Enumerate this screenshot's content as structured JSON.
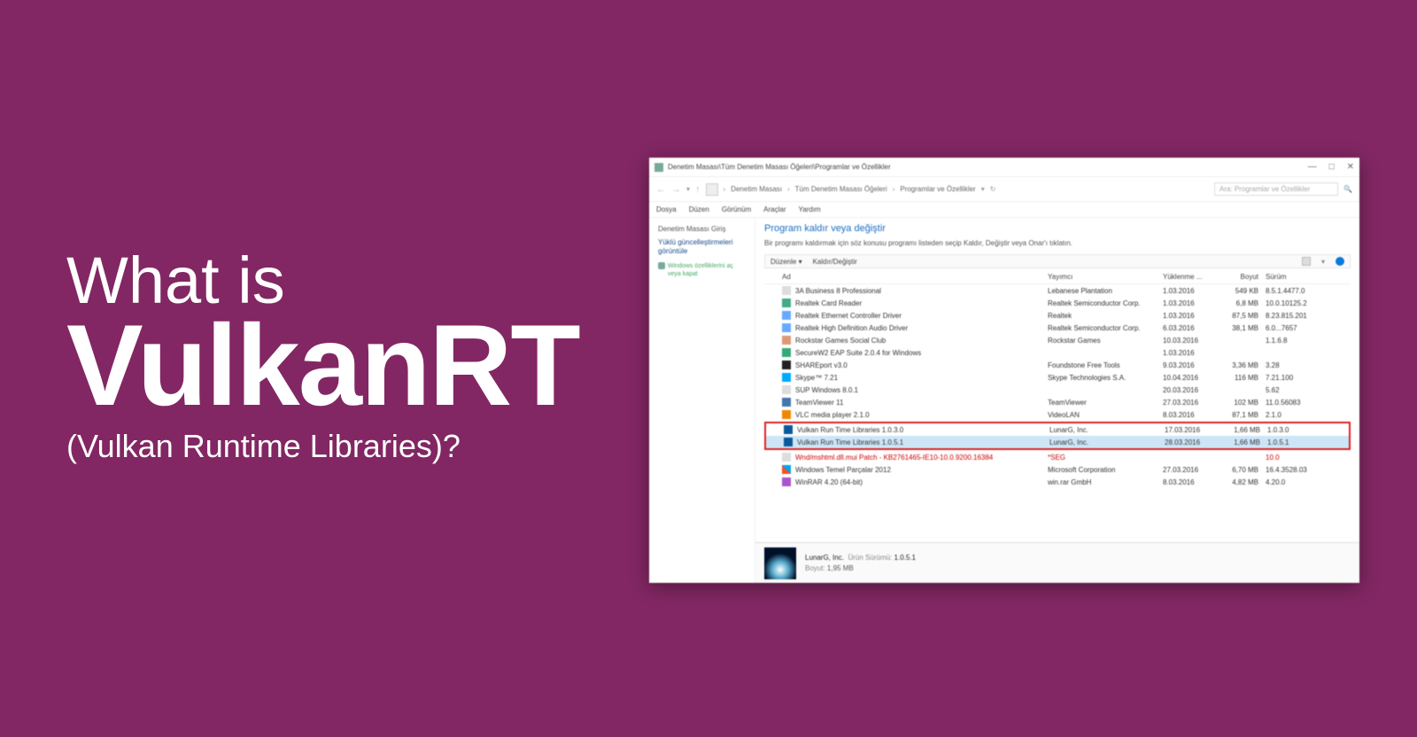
{
  "hero": {
    "line1": "What is",
    "line2": "VulkanRT",
    "line3": "(Vulkan Runtime Libraries)?"
  },
  "window": {
    "title": "Denetim Masası\\Tüm Denetim Masası Öğeleri\\Programlar ve Özellikler",
    "controls": {
      "min": "—",
      "max": "□",
      "close": "✕"
    },
    "nav": {
      "back": "←",
      "fwd": "→",
      "up": "↑",
      "crumbs": [
        "Denetim Masası",
        "Tüm Denetim Masası Öğeleri",
        "Programlar ve Özellikler"
      ],
      "search_placeholder": "Ara: Programlar ve Özellikler",
      "refresh": "↻"
    },
    "menu": [
      "Dosya",
      "Düzen",
      "Görünüm",
      "Araçlar",
      "Yardım"
    ],
    "sidebar": {
      "head": "Denetim Masası Giriş",
      "links": [
        "Yüklü güncelleştirmeleri görüntüle",
        "Windows özelliklerini aç veya kapat"
      ]
    },
    "main": {
      "title": "Program kaldır veya değiştir",
      "subtitle": "Bir programı kaldırmak için söz konusu programı listeden seçip Kaldır, Değiştir veya Onar'ı tıklatın."
    },
    "toolbar": {
      "organize": "Düzenle ▾",
      "change": "Kaldır/Değiştir"
    },
    "columns": {
      "name": "Ad",
      "publisher": "Yayımcı",
      "date": "Yüklenme ...",
      "size": "Boyut",
      "version": "Sürüm"
    },
    "programs": [
      {
        "name": "3A Business 8 Professional",
        "publisher": "Lebanese Plantation",
        "date": "1.03.2016",
        "size": "549 KB",
        "version": "8.5.1.4477.0",
        "ico": "generic"
      },
      {
        "name": "Realtek Card Reader",
        "publisher": "Realtek Semiconductor Corp.",
        "date": "1.03.2016",
        "size": "6,8 MB",
        "version": "10.0.10125.2",
        "ico": "blue"
      },
      {
        "name": "Realtek Ethernet Controller Driver",
        "publisher": "Realtek",
        "date": "1.03.2016",
        "size": "87,5 MB",
        "version": "8.23.815.201",
        "ico": "network"
      },
      {
        "name": "Realtek High Definition Audio Driver",
        "publisher": "Realtek Semiconductor Corp.",
        "date": "6.03.2016",
        "size": "38,1 MB",
        "version": "6.0...7657",
        "ico": "network"
      },
      {
        "name": "Rockstar Games Social Club",
        "publisher": "Rockstar Games",
        "date": "10.03.2016",
        "size": "",
        "version": "1.1.6.8",
        "ico": "box"
      },
      {
        "name": "SecureW2 EAP Suite 2.0.4 for Windows",
        "publisher": "",
        "date": "1.03.2016",
        "size": "",
        "version": "",
        "ico": "shield"
      },
      {
        "name": "SHAREport v3.0",
        "publisher": "Foundstone Free Tools",
        "date": "9.03.2016",
        "size": "3,36 MB",
        "version": "3.28",
        "ico": "black"
      },
      {
        "name": "Skype™ 7.21",
        "publisher": "Skype Technologies S.A.",
        "date": "10.04.2016",
        "size": "116 MB",
        "version": "7.21.100",
        "ico": "skype"
      },
      {
        "name": "SUP Windows 8.0.1",
        "publisher": "",
        "date": "20.03.2016",
        "size": "",
        "version": "5.62",
        "ico": "generic"
      },
      {
        "name": "TeamViewer 11",
        "publisher": "TeamViewer",
        "date": "27.03.2016",
        "size": "102 MB",
        "version": "11.0.56083",
        "ico": "team"
      },
      {
        "name": "VLC media player 2.1.0",
        "publisher": "VideoLAN",
        "date": "8.03.2016",
        "size": "87,1 MB",
        "version": "2.1.0",
        "ico": "orange"
      }
    ],
    "highlighted": [
      {
        "name": "Vulkan Run Time Libraries 1.0.3.0",
        "publisher": "LunarG, Inc.",
        "date": "17.03.2016",
        "size": "1,66 MB",
        "version": "1.0.3.0",
        "ico": "vulkan",
        "sel": false
      },
      {
        "name": "Vulkan Run Time Libraries 1.0.5.1",
        "publisher": "LunarG, Inc.",
        "date": "28.03.2016",
        "size": "1,66 MB",
        "version": "1.0.5.1",
        "ico": "vulkan",
        "sel": true
      }
    ],
    "programs_after": [
      {
        "name": "Wnd/mshtml.dll.mui Patch - KB2761465-IE10-10.0.9200.16384",
        "publisher": "*SEG",
        "date": "",
        "size": "",
        "version": "10.0",
        "ico": "generic",
        "red": true
      },
      {
        "name": "Windows Temel Parçalar 2012",
        "publisher": "Microsoft Corporation",
        "date": "27.03.2016",
        "size": "6,70 MB",
        "version": "16.4.3528.03",
        "ico": "win"
      },
      {
        "name": "WinRAR 4.20 (64-bit)",
        "publisher": "win.rar GmbH",
        "date": "8.03.2016",
        "size": "4,82 MB",
        "version": "4.20.0",
        "ico": "rar"
      }
    ],
    "detail": {
      "publisher": "LunarG, Inc.",
      "product_label": "Ürün Sürümü:",
      "product": "1.0.5.1",
      "size_label": "Boyut:",
      "size": "1,95 MB"
    }
  }
}
